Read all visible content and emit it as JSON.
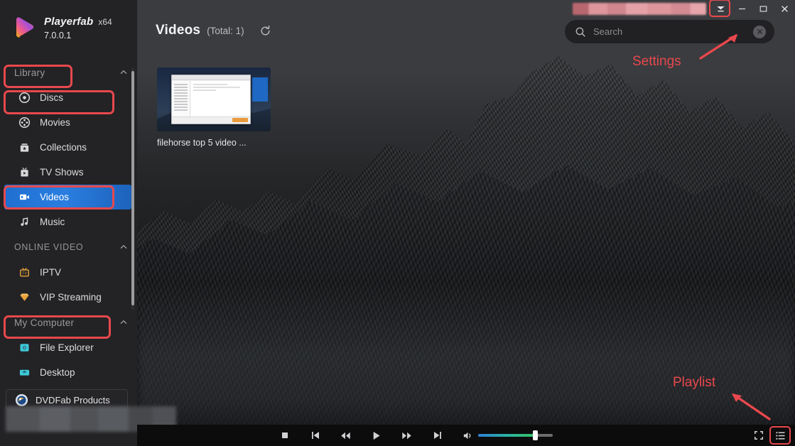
{
  "app": {
    "brand_name": "Playerfab",
    "architecture": "x64",
    "version": "7.0.0.1"
  },
  "titlebar": {
    "redacted_label": "",
    "settings_icon": "chevron-down-settings-icon",
    "minimize_label": "–",
    "maximize_label": "□",
    "close_label": "✕"
  },
  "sidebar": {
    "groups": [
      {
        "title": "Library",
        "uppercase": false,
        "collapse_icon": "chevron-up-icon",
        "items": [
          {
            "label": "Discs",
            "icon": "disc-icon",
            "active": false
          },
          {
            "label": "Movies",
            "icon": "film-reel-icon",
            "active": false
          },
          {
            "label": "Collections",
            "icon": "collections-icon",
            "active": false
          },
          {
            "label": "TV Shows",
            "icon": "tv-icon",
            "active": false
          },
          {
            "label": "Videos",
            "icon": "video-camera-icon",
            "active": true
          },
          {
            "label": "Music",
            "icon": "music-note-icon",
            "active": false
          }
        ]
      },
      {
        "title": "ONLINE VIDEO",
        "uppercase": true,
        "collapse_icon": "chevron-up-icon",
        "items": [
          {
            "label": "IPTV",
            "icon": "iptv-icon",
            "active": false
          },
          {
            "label": "VIP Streaming",
            "icon": "vip-diamond-icon",
            "active": false
          }
        ]
      },
      {
        "title": "My Computer",
        "uppercase": false,
        "collapse_icon": "chevron-up-icon",
        "items": [
          {
            "label": "File Explorer",
            "icon": "folder-explorer-icon",
            "active": false
          },
          {
            "label": "Desktop",
            "icon": "desktop-icon",
            "active": false
          }
        ]
      }
    ],
    "footer": {
      "label": "DVDFab Products",
      "icon": "dvdfab-logo-icon"
    },
    "redacted_footer": ""
  },
  "content": {
    "page_title": "Videos",
    "total_text": "(Total: 1)",
    "refresh_icon": "refresh-icon",
    "search": {
      "placeholder": "Search",
      "value": "",
      "search_icon": "search-icon",
      "clear_icon": "close-circle-icon"
    },
    "videos": [
      {
        "title": "filehorse top 5 video ..."
      }
    ]
  },
  "player": {
    "controls": [
      {
        "name": "stop-button",
        "icon": "stop-icon"
      },
      {
        "name": "previous-button",
        "icon": "skip-previous-icon"
      },
      {
        "name": "rewind-button",
        "icon": "rewind-icon"
      },
      {
        "name": "play-button",
        "icon": "play-icon"
      },
      {
        "name": "forward-button",
        "icon": "fast-forward-icon"
      },
      {
        "name": "next-button",
        "icon": "skip-next-icon"
      },
      {
        "name": "volume-button",
        "icon": "volume-icon"
      }
    ],
    "volume_percent": 76,
    "fullscreen_icon": "fullscreen-icon",
    "playlist_icon": "playlist-icon"
  },
  "annotations": {
    "settings_label": "Settings",
    "playlist_label": "Playlist",
    "highlight_color": "#e8484d"
  }
}
